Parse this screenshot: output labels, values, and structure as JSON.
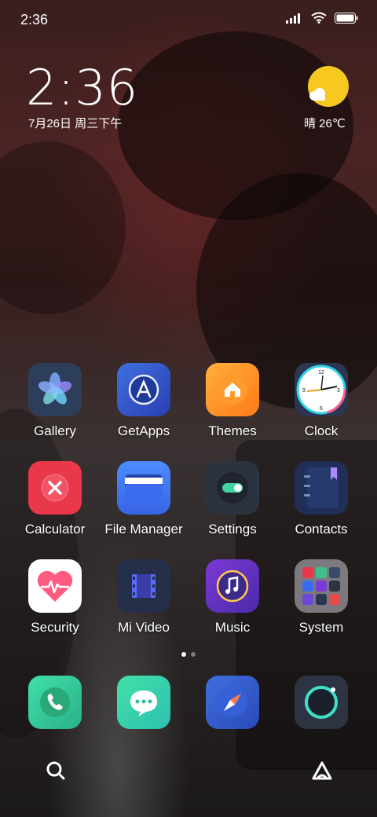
{
  "status": {
    "time": "2:36"
  },
  "widget": {
    "clock": "2:36",
    "date": "7月26日 周三下午",
    "weather": "晴 26℃"
  },
  "apps": [
    {
      "label": "Gallery"
    },
    {
      "label": "GetApps"
    },
    {
      "label": "Themes"
    },
    {
      "label": "Clock"
    },
    {
      "label": "Calculator"
    },
    {
      "label": "File Manager"
    },
    {
      "label": "Settings"
    },
    {
      "label": "Contacts"
    },
    {
      "label": "Security"
    },
    {
      "label": "Mi Video"
    },
    {
      "label": "Music"
    },
    {
      "label": "System"
    }
  ],
  "dock": [
    "phone-icon",
    "messages-icon",
    "browser-icon",
    "camera-icon"
  ],
  "page_indicator": {
    "current": 1,
    "total": 2
  }
}
